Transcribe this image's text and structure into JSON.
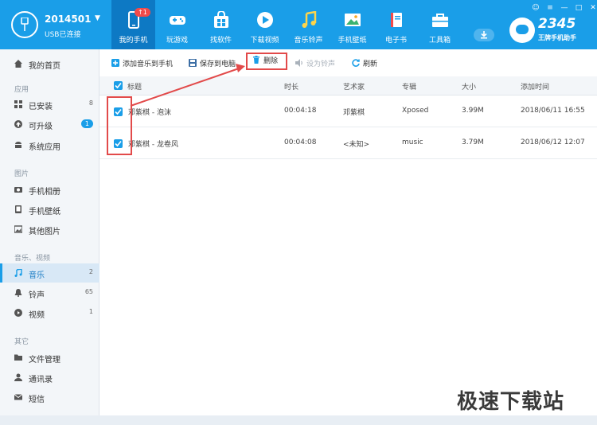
{
  "device": {
    "name": "2014501",
    "status": "USB已连接"
  },
  "nav": [
    {
      "label": "我的手机",
      "icon": "phone-icon",
      "active": true,
      "badge": "↑1"
    },
    {
      "label": "玩游戏",
      "icon": "gamepad-icon"
    },
    {
      "label": "找软件",
      "icon": "app-store-icon"
    },
    {
      "label": "下载视频",
      "icon": "play-icon"
    },
    {
      "label": "音乐铃声",
      "icon": "music-note-icon"
    },
    {
      "label": "手机壁纸",
      "icon": "image-icon"
    },
    {
      "label": "电子书",
      "icon": "book-icon"
    },
    {
      "label": "工具箱",
      "icon": "toolbox-icon"
    }
  ],
  "brand": {
    "number": "2345",
    "slogan": "王牌手机助手"
  },
  "sidebar": {
    "home": "我的首页",
    "groups": {
      "apps": "应用",
      "pictures": "图片",
      "media": "音乐、视频",
      "other": "其它"
    },
    "items": {
      "installed": {
        "label": "已安装",
        "count": "8"
      },
      "upgradable": {
        "label": "可升级",
        "count": "1"
      },
      "system_apps": {
        "label": "系统应用"
      },
      "camera": {
        "label": "手机相册"
      },
      "wallpaper": {
        "label": "手机壁纸"
      },
      "other_pictures": {
        "label": "其他图片"
      },
      "music": {
        "label": "音乐",
        "count": "2"
      },
      "ringtones": {
        "label": "铃声",
        "count": "65"
      },
      "video": {
        "label": "视频",
        "count": "1"
      },
      "files": {
        "label": "文件管理"
      },
      "contacts": {
        "label": "通讯录"
      },
      "sms": {
        "label": "短信"
      }
    }
  },
  "toolbar": {
    "add": "添加音乐到手机",
    "save": "保存到电脑",
    "delete": "删除",
    "set_ringtone": "设为铃声",
    "refresh": "刷新"
  },
  "table": {
    "headers": {
      "title": "标题",
      "duration": "时长",
      "artist": "艺术家",
      "album": "专辑",
      "size": "大小",
      "added": "添加时间"
    },
    "rows": [
      {
        "title": "邓紫棋 - 泡沫",
        "duration": "00:04:18",
        "artist": "邓紫棋",
        "album": "Xposed",
        "size": "3.99M",
        "added": "2018/06/11 16:55"
      },
      {
        "title": "邓紫棋 - 龙卷风",
        "duration": "00:04:08",
        "artist": "<未知>",
        "album": "music",
        "size": "3.79M",
        "added": "2018/06/12 12:07"
      }
    ]
  },
  "watermark": "极速下载站",
  "colors": {
    "accent": "#1a9ee8",
    "annotation": "#e24a4a"
  }
}
